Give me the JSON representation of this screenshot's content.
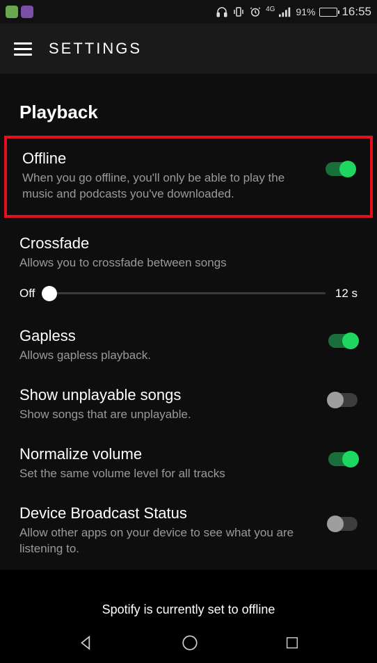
{
  "status": {
    "network_label": "4G",
    "battery_percent": "91%",
    "time": "16:55"
  },
  "header": {
    "title": "SETTINGS"
  },
  "section": {
    "title": "Playback"
  },
  "settings": {
    "offline": {
      "title": "Offline",
      "desc": "When you go offline, you'll only be able to play the music and podcasts you've downloaded.",
      "on": true
    },
    "crossfade": {
      "title": "Crossfade",
      "desc": "Allows you to crossfade between songs",
      "slider_min_label": "Off",
      "slider_max_label": "12 s"
    },
    "gapless": {
      "title": "Gapless",
      "desc": "Allows gapless playback.",
      "on": true
    },
    "unplayable": {
      "title": "Show unplayable songs",
      "desc": "Show songs that are unplayable.",
      "on": false
    },
    "normalize": {
      "title": "Normalize volume",
      "desc": "Set the same volume level for all tracks",
      "on": true
    },
    "broadcast": {
      "title": "Device Broadcast Status",
      "desc": "Allow other apps on your device to see what you are listening to.",
      "on": false
    }
  },
  "caption": "Spotify is currently set to offline"
}
